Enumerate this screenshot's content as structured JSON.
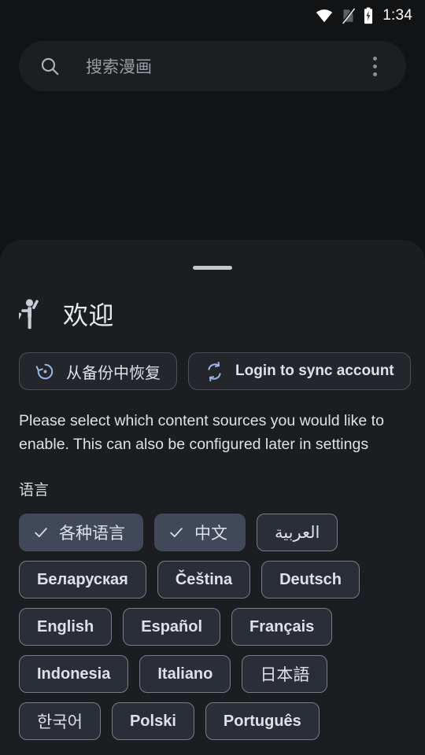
{
  "status_bar": {
    "time": "1:34",
    "icons": [
      "wifi-icon",
      "no-sim-icon",
      "battery-charging-icon"
    ]
  },
  "search": {
    "placeholder": "搜索漫画",
    "value": "",
    "icon": "search-icon",
    "overflow_icon": "more-vert-icon"
  },
  "sheet": {
    "handle": "drag-handle",
    "welcome": {
      "icon": "waving-person-icon",
      "title": "欢迎"
    },
    "actions": [
      {
        "label": "从备份中恢复",
        "icon": "restore-icon",
        "cjk": true
      },
      {
        "label": "Login to sync account",
        "icon": "sync-icon",
        "cjk": false
      }
    ],
    "description": "Please select which content sources you would like to enable. This can also be configured later in settings",
    "language_section": {
      "label": "语言",
      "chips": [
        {
          "label": "各种语言",
          "selected": true,
          "cjk": true
        },
        {
          "label": "中文",
          "selected": true,
          "cjk": true
        },
        {
          "label": "العربية",
          "selected": false,
          "cjk": true
        },
        {
          "label": "Беларуская",
          "selected": false,
          "cjk": false
        },
        {
          "label": "Čeština",
          "selected": false,
          "cjk": false
        },
        {
          "label": "Deutsch",
          "selected": false,
          "cjk": false
        },
        {
          "label": "English",
          "selected": false,
          "cjk": false
        },
        {
          "label": "Español",
          "selected": false,
          "cjk": false
        },
        {
          "label": "Français",
          "selected": false,
          "cjk": false
        },
        {
          "label": "Indonesia",
          "selected": false,
          "cjk": false
        },
        {
          "label": "Italiano",
          "selected": false,
          "cjk": false
        },
        {
          "label": "日本語",
          "selected": false,
          "cjk": true
        },
        {
          "label": "한국어",
          "selected": false,
          "cjk": true
        },
        {
          "label": "Polski",
          "selected": false,
          "cjk": false
        },
        {
          "label": "Português",
          "selected": false,
          "cjk": false
        }
      ]
    }
  },
  "colors": {
    "background": "#121315",
    "sheet": "#1b1d21",
    "search_bar": "#1d1e21",
    "accent_blue": "#9ab7ec",
    "chip_selected": "#40485a",
    "chip_unselected": "#2a2e38",
    "text_primary": "#dfe1e6",
    "text_secondary": "#9b9ea4"
  }
}
